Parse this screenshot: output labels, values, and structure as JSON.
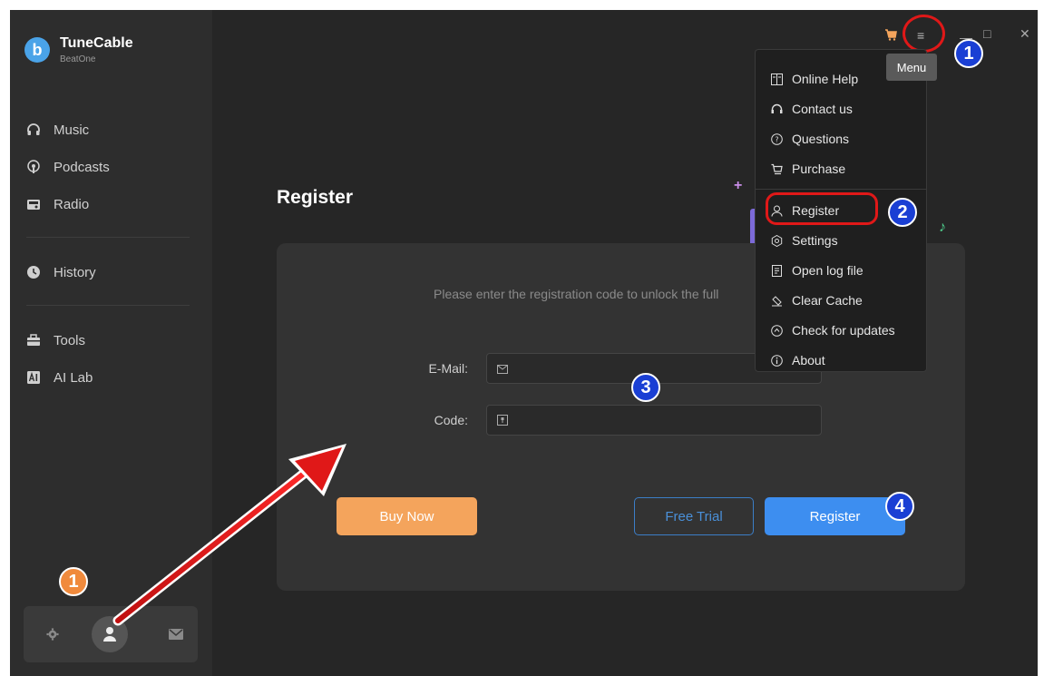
{
  "app": {
    "name": "TuneCable",
    "subtitle": "BeatOne",
    "logo_letter": "b"
  },
  "sidebar": {
    "items": [
      {
        "label": "Music",
        "icon": "headphones-icon"
      },
      {
        "label": "Podcasts",
        "icon": "podcast-icon"
      },
      {
        "label": "Radio",
        "icon": "radio-icon"
      },
      {
        "label": "History",
        "icon": "clock-icon"
      },
      {
        "label": "Tools",
        "icon": "toolbox-icon"
      },
      {
        "label": "AI Lab",
        "icon": "ai-lab-icon"
      }
    ],
    "bottom": {
      "settings_icon": "gear-icon",
      "user_icon": "user-icon",
      "mail_icon": "mail-icon"
    }
  },
  "main": {
    "title": "Register",
    "hint": "Please enter the registration code to unlock the full",
    "email_label": "E-Mail:",
    "code_label": "Code:",
    "email_value": "",
    "code_value": "",
    "buttons": {
      "buy_now": "Buy Now",
      "free_trial": "Free Trial",
      "register": "Register"
    }
  },
  "toolbar": {
    "cart_icon": "cart-icon",
    "menu_icon": "hamburger-menu-icon",
    "tooltip": "Menu"
  },
  "menu": {
    "items": [
      {
        "label": "Online Help",
        "icon": "help-book-icon"
      },
      {
        "label": "Contact us",
        "icon": "headset-icon"
      },
      {
        "label": "Questions",
        "icon": "question-circle-icon"
      },
      {
        "label": "Purchase",
        "icon": "cart-icon"
      },
      {
        "label": "Register",
        "icon": "user-icon"
      },
      {
        "label": "Settings",
        "icon": "gear-icon"
      },
      {
        "label": "Open log file",
        "icon": "file-icon"
      },
      {
        "label": "Clear Cache",
        "icon": "eraser-icon"
      },
      {
        "label": "Check for updates",
        "icon": "refresh-icon"
      },
      {
        "label": "About",
        "icon": "info-icon"
      }
    ]
  },
  "annotations": {
    "step1": "1",
    "step2": "2",
    "step3": "3",
    "step4": "4"
  },
  "colors": {
    "accent_blue": "#3d8ef0",
    "buy_orange": "#f4a45c",
    "badge_blue": "#1a3fd4",
    "badge_orange": "#f08a3c",
    "highlight_red": "#e01818"
  }
}
